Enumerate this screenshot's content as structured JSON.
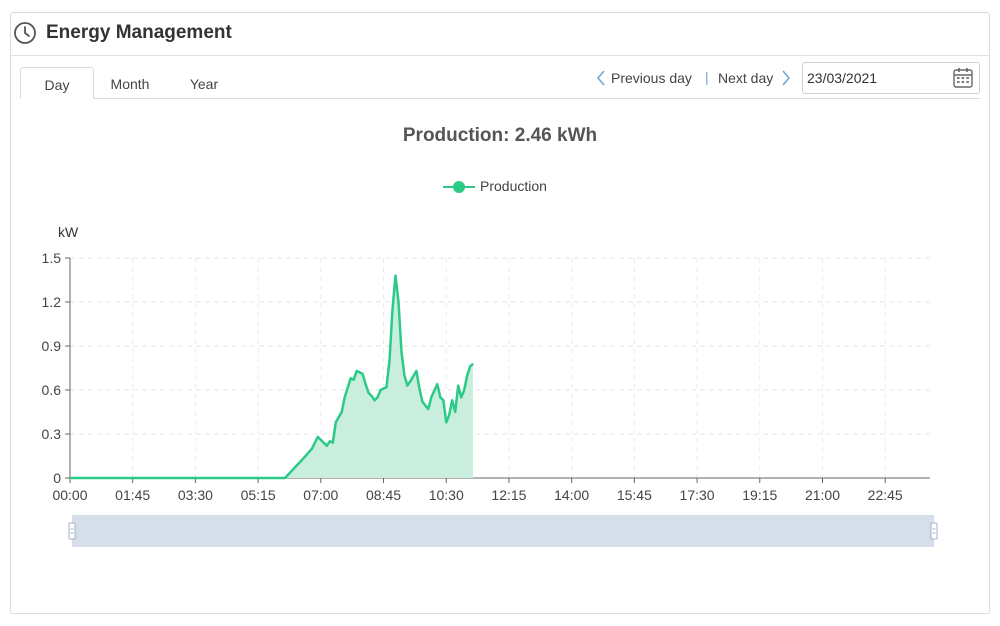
{
  "header": {
    "title": "Energy Management",
    "icon": "clock-icon"
  },
  "tabs": [
    {
      "label": "Day",
      "active": true
    },
    {
      "label": "Month",
      "active": false
    },
    {
      "label": "Year",
      "active": false
    }
  ],
  "date_nav": {
    "previous_label": "Previous day",
    "next_label": "Next day",
    "separator": "|",
    "date_value": "23/03/2021",
    "calendar_icon": "calendar-icon"
  },
  "colors": {
    "accent": "#2bca87",
    "area_fill": "#c9eedd",
    "nav_link": "#6fa8dc",
    "slider": "#d6deea"
  },
  "chart_data": {
    "type": "area",
    "title": "Production: 2.46 kWh",
    "ylabel": "kW",
    "xlabel": "",
    "ylim": [
      0,
      1.5
    ],
    "xlim": [
      "00:00",
      "24:00"
    ],
    "y_ticks": [
      0,
      0.3,
      0.6,
      0.9,
      1.2,
      1.5
    ],
    "y_tick_labels": [
      "0",
      "0.3",
      "0.6",
      "0.9",
      "1.2",
      "1.5"
    ],
    "x_ticks": [
      "00:00",
      "01:45",
      "03:30",
      "05:15",
      "07:00",
      "08:45",
      "10:30",
      "12:15",
      "14:00",
      "15:45",
      "17:30",
      "19:15",
      "21:00",
      "22:45"
    ],
    "grid": true,
    "legend_position": "top-center",
    "series": [
      {
        "name": "Production",
        "x": [
          "00:00",
          "06:00",
          "06:30",
          "06:45",
          "06:55",
          "07:00",
          "07:10",
          "07:15",
          "07:20",
          "07:25",
          "07:35",
          "07:40",
          "07:50",
          "07:55",
          "08:00",
          "08:10",
          "08:15",
          "08:20",
          "08:25",
          "08:30",
          "08:35",
          "08:40",
          "08:50",
          "08:55",
          "09:00",
          "09:05",
          "09:10",
          "09:15",
          "09:20",
          "09:25",
          "09:30",
          "09:40",
          "09:45",
          "09:50",
          "10:00",
          "10:05",
          "10:15",
          "10:20",
          "10:25",
          "10:30",
          "10:35",
          "10:40",
          "10:45",
          "10:50",
          "10:55",
          "11:00",
          "11:05",
          "11:10",
          "11:15"
        ],
        "y": [
          0,
          0,
          0.13,
          0.2,
          0.28,
          0.26,
          0.22,
          0.25,
          0.24,
          0.38,
          0.45,
          0.55,
          0.68,
          0.67,
          0.73,
          0.71,
          0.64,
          0.58,
          0.56,
          0.53,
          0.55,
          0.6,
          0.62,
          0.8,
          1.15,
          1.38,
          1.2,
          0.86,
          0.7,
          0.63,
          0.66,
          0.73,
          0.61,
          0.52,
          0.47,
          0.55,
          0.64,
          0.55,
          0.53,
          0.38,
          0.43,
          0.53,
          0.45,
          0.63,
          0.55,
          0.6,
          0.7,
          0.76,
          0.78
        ]
      }
    ],
    "zoom_range": [
      "00:00",
      "24:00"
    ]
  }
}
